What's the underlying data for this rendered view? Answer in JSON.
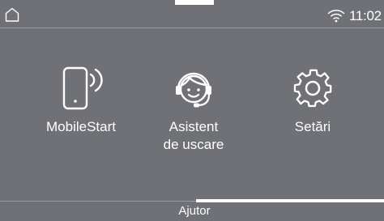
{
  "status_bar": {
    "home_icon": "home-icon",
    "wifi_icon": "wifi-icon",
    "time": "11:02"
  },
  "tiles": [
    {
      "icon": "mobile-phone-signal-icon",
      "label": "MobileStart"
    },
    {
      "icon": "headset-assistant-icon",
      "label": "Asistent\nde uscare"
    },
    {
      "icon": "gear-icon",
      "label": "Setări"
    }
  ],
  "footer": {
    "help_label": "Ajutor"
  },
  "colors": {
    "background": "#6f7176",
    "foreground": "#ffffff",
    "divider": "#9a9ca0"
  }
}
